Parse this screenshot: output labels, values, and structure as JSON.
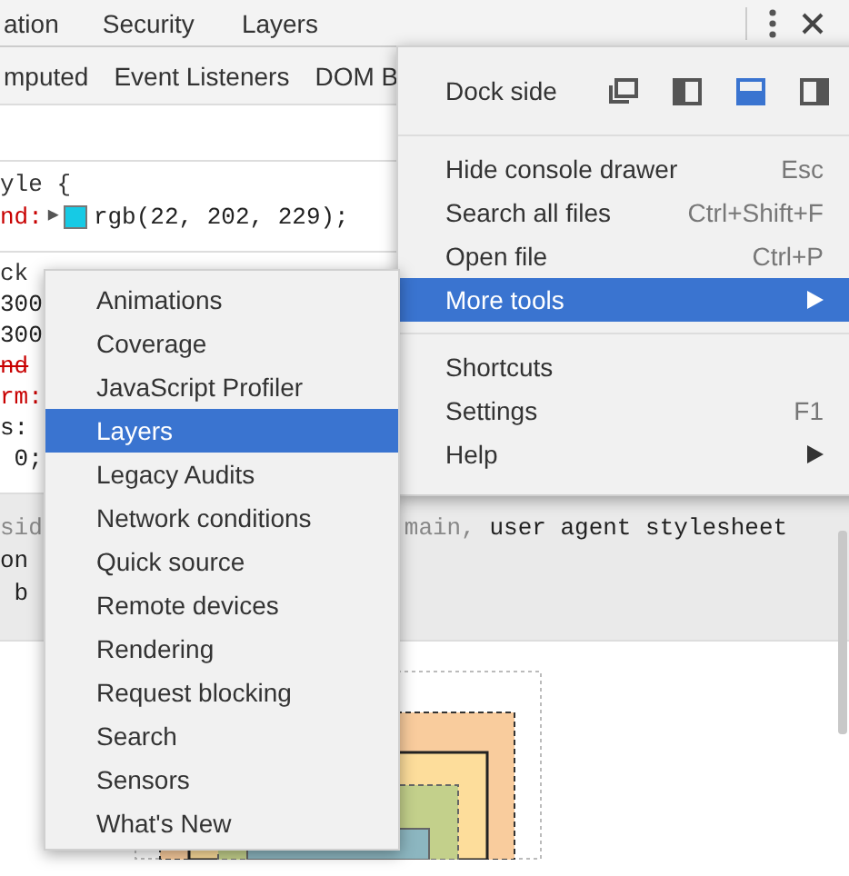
{
  "tabs": [
    {
      "label": "ation",
      "selected": false
    },
    {
      "label": "Security",
      "selected": false
    },
    {
      "label": "Layers",
      "selected": false
    }
  ],
  "subtabs": [
    {
      "label": "mputed",
      "selected": false
    },
    {
      "label": "Event Listeners",
      "selected": false
    },
    {
      "label": "DOM B",
      "selected": false
    }
  ],
  "rules": [
    {
      "lines": [
        [
          {
            "kind": "selector",
            "text": "yle {"
          }
        ],
        [
          {
            "kind": "prop",
            "text": "nd:"
          },
          {
            "kind": "expander",
            "text": "▶"
          },
          {
            "kind": "swatch",
            "color": "#16cae5"
          },
          {
            "kind": "value",
            "text": "rgb(22, 202, 229);"
          }
        ]
      ]
    },
    {
      "lines": [
        [
          {
            "kind": "selector",
            "text": "ck"
          }
        ],
        [
          {
            "kind": "value",
            "text": "300"
          }
        ],
        [
          {
            "kind": "value",
            "text": "300"
          }
        ],
        [
          {
            "kind": "strike",
            "text": "nd"
          }
        ],
        [
          {
            "kind": "prop",
            "text": "rm:"
          }
        ],
        [
          {
            "kind": "value",
            "text": "s:"
          }
        ],
        [
          {
            "kind": "value",
            "text": " 0;"
          }
        ]
      ]
    }
  ],
  "inherited": {
    "lines": [
      [
        {
          "kind": "muted",
          "text": "sid"
        },
        {
          "kind": "gap"
        },
        {
          "kind": "muted",
          "text": "main,"
        },
        {
          "kind": "value",
          "text": " user agent stylesheet"
        }
      ],
      [
        {
          "kind": "value",
          "text": "on"
        }
      ],
      [
        {
          "kind": "value",
          "text": " b"
        }
      ]
    ]
  },
  "main_menu": {
    "dock": {
      "label": "Dock side",
      "options": [
        {
          "kind": "undock",
          "selected": false
        },
        {
          "kind": "left",
          "selected": false
        },
        {
          "kind": "bottom",
          "selected": true
        },
        {
          "kind": "right",
          "selected": false
        }
      ]
    },
    "groups": [
      [
        {
          "label": "Hide console drawer",
          "shortcut": "Esc",
          "selected": false
        },
        {
          "label": "Search all files",
          "shortcut": "Ctrl+Shift+F",
          "selected": false
        },
        {
          "label": "Open file",
          "shortcut": "Ctrl+P",
          "selected": false
        },
        {
          "label": "More tools",
          "submenu": true,
          "selected": true
        }
      ],
      [
        {
          "label": "Shortcuts",
          "selected": false
        },
        {
          "label": "Settings",
          "shortcut": "F1",
          "selected": false
        },
        {
          "label": "Help",
          "submenu": true,
          "selected": false
        }
      ]
    ]
  },
  "submenu": {
    "items": [
      {
        "label": "Animations",
        "selected": false
      },
      {
        "label": "Coverage",
        "selected": false
      },
      {
        "label": "JavaScript Profiler",
        "selected": false
      },
      {
        "label": "Layers",
        "selected": true
      },
      {
        "label": "Legacy Audits",
        "selected": false
      },
      {
        "label": "Network conditions",
        "selected": false
      },
      {
        "label": "Quick source",
        "selected": false
      },
      {
        "label": "Remote devices",
        "selected": false
      },
      {
        "label": "Rendering",
        "selected": false
      },
      {
        "label": "Request blocking",
        "selected": false
      },
      {
        "label": "Search",
        "selected": false
      },
      {
        "label": "Sensors",
        "selected": false
      },
      {
        "label": "What's New",
        "selected": false
      }
    ]
  }
}
